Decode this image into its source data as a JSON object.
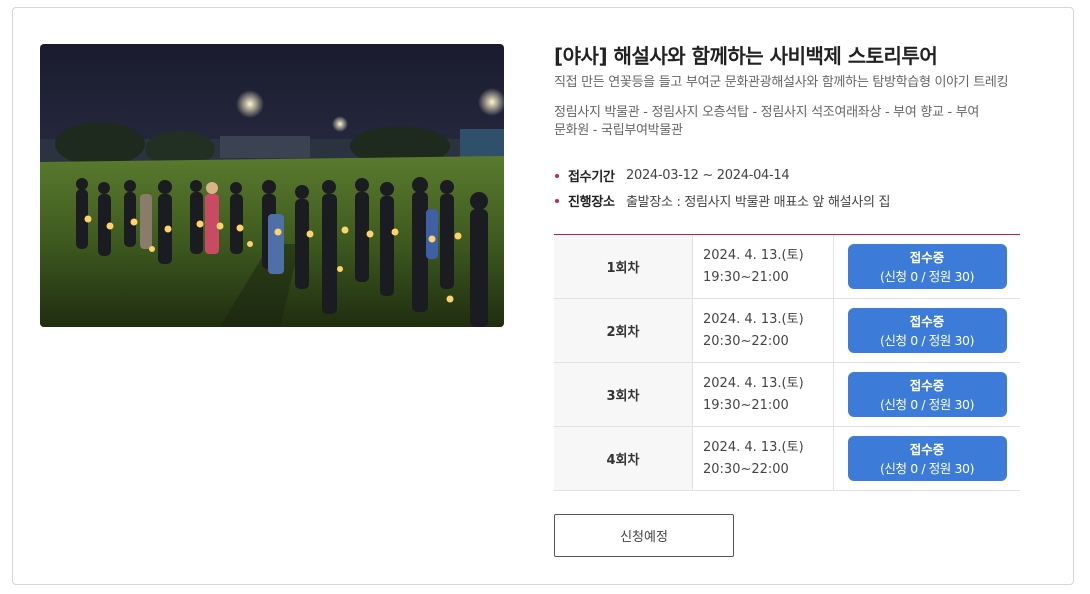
{
  "program": {
    "title": "[야사] 해설사와 함께하는 사비백제 스토리투어",
    "subtitle": "직접 만든 연꽃등을 들고 부여군 문화관광해설사와 함께하는 탐방학습형 이야기 트레킹",
    "route": "정림사지 박물관 - 정림사지 오층석탑 - 정림사지 석조여래좌상 - 부여 향교 - 부여 문화원 - 국립부여박물관",
    "image_alt": "야간 연꽃등 행사 사진"
  },
  "meta": {
    "period_label": "접수기간",
    "period_value": "2024-03-12 ~ 2024-04-14",
    "place_label": "진행장소",
    "place_value": "출발장소 : 정림사지 박물관 매표소 앞 해설사의 집"
  },
  "sessions": [
    {
      "name": "1회차",
      "date": "2024. 4. 13.(토)",
      "time": "19:30~21:00",
      "status": "접수중",
      "capacity": "(신청 0 / 정원 30)"
    },
    {
      "name": "2회차",
      "date": "2024. 4. 13.(토)",
      "time": "20:30~22:00",
      "status": "접수중",
      "capacity": "(신청 0 / 정원 30)"
    },
    {
      "name": "3회차",
      "date": "2024. 4. 13.(토)",
      "time": "19:30~21:00",
      "status": "접수중",
      "capacity": "(신청 0 / 정원 30)"
    },
    {
      "name": "4회차",
      "date": "2024. 4. 13.(토)",
      "time": "20:30~22:00",
      "status": "접수중",
      "capacity": "(신청 0 / 정원 30)"
    }
  ],
  "apply_button": "신청예정",
  "colors": {
    "accent_red": "#c8264a",
    "status_blue": "#3d7bd9",
    "border": "#d6d6d6"
  }
}
